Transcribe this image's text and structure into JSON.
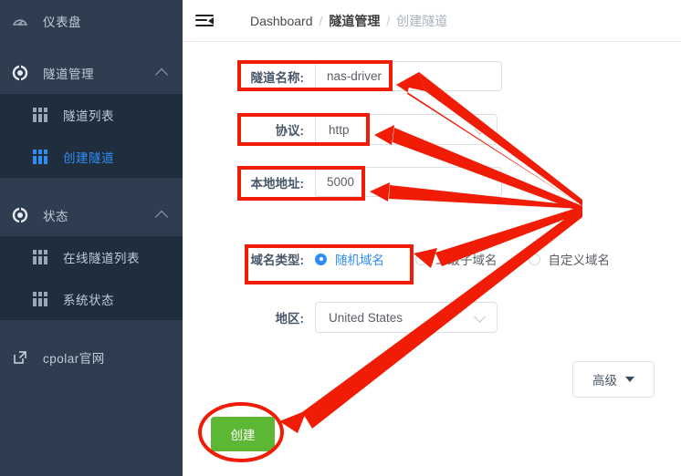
{
  "sidebar": {
    "items": [
      {
        "label": "仪表盘",
        "icon": "dashboard-icon",
        "type": "top",
        "expandable": false
      },
      {
        "label": "隧道管理",
        "icon": "tunnel-icon",
        "type": "top",
        "expandable": true,
        "expanded": true
      },
      {
        "label": "隧道列表",
        "icon": "grid-icon",
        "type": "sub",
        "active": false
      },
      {
        "label": "创建隧道",
        "icon": "grid-icon",
        "type": "sub",
        "active": true
      },
      {
        "label": "状态",
        "icon": "status-icon",
        "type": "top",
        "expandable": true,
        "expanded": true
      },
      {
        "label": "在线隧道列表",
        "icon": "grid-icon",
        "type": "sub",
        "active": false
      },
      {
        "label": "系统状态",
        "icon": "grid-icon",
        "type": "sub",
        "active": false
      },
      {
        "label": "cpolar官网",
        "icon": "external-link-icon",
        "type": "top",
        "expandable": false
      }
    ]
  },
  "header": {
    "menu_toggle_icon": "collapse-menu-icon",
    "breadcrumb": {
      "item1": "Dashboard",
      "sep1": "/",
      "item2": "隧道管理",
      "sep2": "/",
      "item3": "创建隧道"
    }
  },
  "form": {
    "tunnel_name": {
      "label": "隧道名称:",
      "value": "nas-driver"
    },
    "protocol": {
      "label": "协议:",
      "value": "http",
      "chevron": "chevron-down-icon"
    },
    "local_address": {
      "label": "本地地址:",
      "value": "5000"
    },
    "domain_type": {
      "label": "域名类型:",
      "options": [
        {
          "label": "随机域名",
          "selected": true
        },
        {
          "label": "二级子域名",
          "selected": false
        },
        {
          "label": "自定义域名",
          "selected": false
        }
      ]
    },
    "region": {
      "label": "地区:",
      "value": "United States",
      "chevron": "chevron-down-icon"
    },
    "advanced_button": {
      "label": "高级",
      "caret": "caret-down-icon"
    },
    "create_button": {
      "label": "创建"
    }
  },
  "colors": {
    "sidebar_bg": "#2e3e50",
    "submenu_bg": "#1f2d3d",
    "accent_blue": "#2f8ef4",
    "create_green": "#5cb735",
    "annotation_red": "#f01c06",
    "text_light": "#bfcbd9"
  }
}
